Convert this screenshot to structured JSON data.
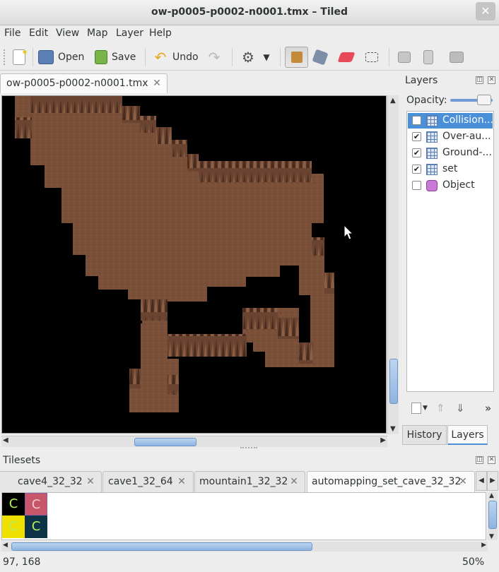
{
  "window": {
    "title": "ow-p0005-p0002-n0001.tmx – Tiled",
    "close_glyph": "✕"
  },
  "menu": [
    "File",
    "Edit",
    "View",
    "Map",
    "Layer",
    "Help"
  ],
  "toolbar": {
    "open_label": "Open",
    "save_label": "Save",
    "undo_label": "Undo"
  },
  "document_tab": {
    "label": "ow-p0005-p0002-n0001.tmx"
  },
  "layers_panel": {
    "title": "Layers",
    "opacity_label": "Opacity:",
    "layers": [
      {
        "name": "Collision...",
        "checked": false,
        "type": "tile",
        "selected": true
      },
      {
        "name": "Over-au...",
        "checked": true,
        "type": "tile",
        "selected": false
      },
      {
        "name": "Ground-...",
        "checked": true,
        "type": "tile",
        "selected": false
      },
      {
        "name": "set",
        "checked": true,
        "type": "tile",
        "selected": false
      },
      {
        "name": "Object",
        "checked": false,
        "type": "object",
        "selected": false
      }
    ],
    "more_glyph": "»"
  },
  "side_tabs": {
    "history": "History",
    "layers": "Layers"
  },
  "tilesets_panel": {
    "title": "Tilesets",
    "tabs": [
      "cave4_32_32",
      "cave1_32_64",
      "mountain1_32_32",
      "automapping_set_cave_32_32"
    ],
    "tile_glyph": "C"
  },
  "status": {
    "coords": "97, 168",
    "zoom": "50%"
  },
  "colors": {
    "cave_floor": "#7a5038",
    "cave_wall": "#5c3a26",
    "selection": "#4a90d9",
    "tile_pink": "#c8566a",
    "tile_yellow": "#f0e000",
    "tile_teal": "#0d3348"
  }
}
